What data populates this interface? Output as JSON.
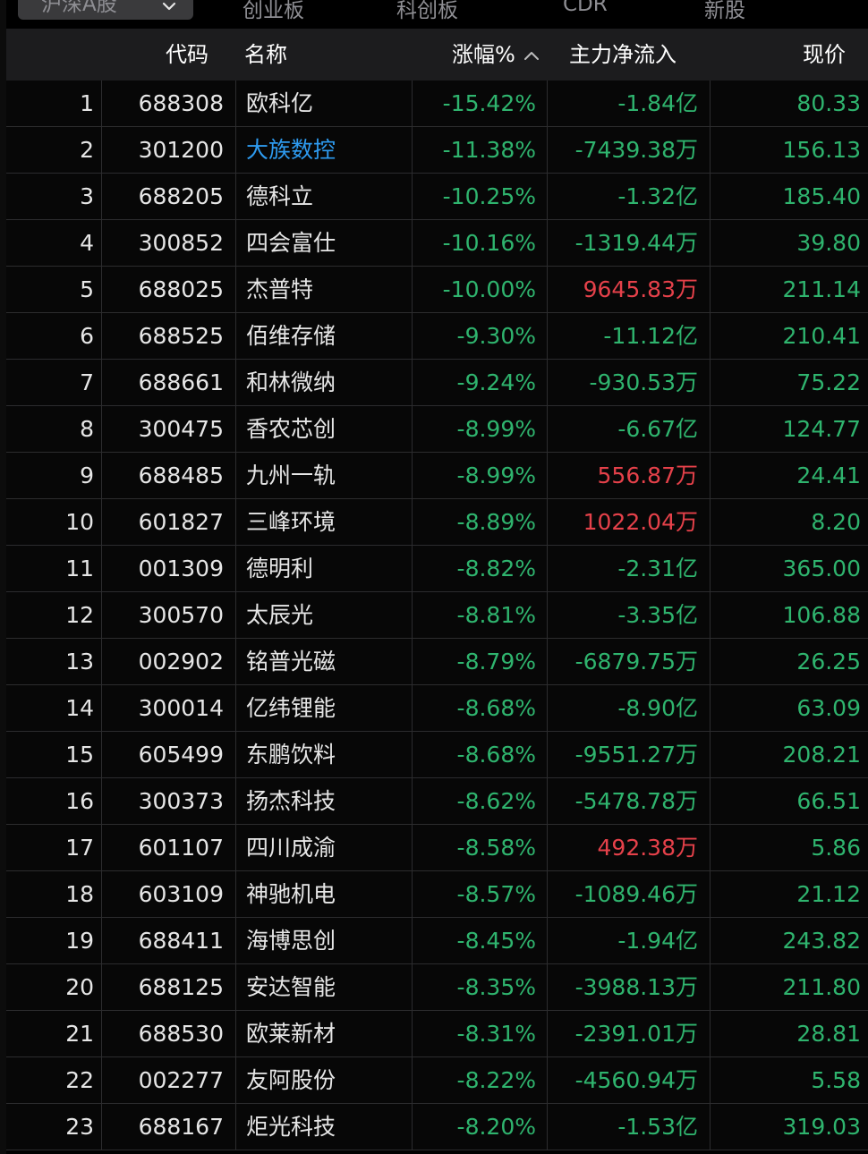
{
  "tabs": {
    "selected": "沪深A股",
    "items": [
      "创业板",
      "科创板",
      "CDR",
      "新股"
    ]
  },
  "columns": {
    "code": "代码",
    "name": "名称",
    "change": "涨幅%",
    "flow": "主力净流入",
    "price": "现价"
  },
  "colors": {
    "down": "#2fb46e",
    "up": "#e5414a",
    "highlight": "#2e9bf0",
    "header_bg": "#1c1c1e"
  },
  "rows": [
    {
      "n": "1",
      "code": "688308",
      "name": "欧科亿",
      "change": "-15.42%",
      "flow": "-1.84亿",
      "price": "80.33",
      "flow_color": "green",
      "name_color": "white"
    },
    {
      "n": "2",
      "code": "301200",
      "name": "大族数控",
      "change": "-11.38%",
      "flow": "-7439.38万",
      "price": "156.13",
      "flow_color": "green",
      "name_color": "blue"
    },
    {
      "n": "3",
      "code": "688205",
      "name": "德科立",
      "change": "-10.25%",
      "flow": "-1.32亿",
      "price": "185.40",
      "flow_color": "green",
      "name_color": "white"
    },
    {
      "n": "4",
      "code": "300852",
      "name": "四会富仕",
      "change": "-10.16%",
      "flow": "-1319.44万",
      "price": "39.80",
      "flow_color": "green",
      "name_color": "white"
    },
    {
      "n": "5",
      "code": "688025",
      "name": "杰普特",
      "change": "-10.00%",
      "flow": "9645.83万",
      "price": "211.14",
      "flow_color": "red",
      "name_color": "white"
    },
    {
      "n": "6",
      "code": "688525",
      "name": "佰维存储",
      "change": "-9.30%",
      "flow": "-11.12亿",
      "price": "210.41",
      "flow_color": "green",
      "name_color": "white"
    },
    {
      "n": "7",
      "code": "688661",
      "name": "和林微纳",
      "change": "-9.24%",
      "flow": "-930.53万",
      "price": "75.22",
      "flow_color": "green",
      "name_color": "white"
    },
    {
      "n": "8",
      "code": "300475",
      "name": "香农芯创",
      "change": "-8.99%",
      "flow": "-6.67亿",
      "price": "124.77",
      "flow_color": "green",
      "name_color": "white"
    },
    {
      "n": "9",
      "code": "688485",
      "name": "九州一轨",
      "change": "-8.99%",
      "flow": "556.87万",
      "price": "24.41",
      "flow_color": "red",
      "name_color": "white"
    },
    {
      "n": "10",
      "code": "601827",
      "name": "三峰环境",
      "change": "-8.89%",
      "flow": "1022.04万",
      "price": "8.20",
      "flow_color": "red",
      "name_color": "white"
    },
    {
      "n": "11",
      "code": "001309",
      "name": "德明利",
      "change": "-8.82%",
      "flow": "-2.31亿",
      "price": "365.00",
      "flow_color": "green",
      "name_color": "white"
    },
    {
      "n": "12",
      "code": "300570",
      "name": "太辰光",
      "change": "-8.81%",
      "flow": "-3.35亿",
      "price": "106.88",
      "flow_color": "green",
      "name_color": "white"
    },
    {
      "n": "13",
      "code": "002902",
      "name": "铭普光磁",
      "change": "-8.79%",
      "flow": "-6879.75万",
      "price": "26.25",
      "flow_color": "green",
      "name_color": "white"
    },
    {
      "n": "14",
      "code": "300014",
      "name": "亿纬锂能",
      "change": "-8.68%",
      "flow": "-8.90亿",
      "price": "63.09",
      "flow_color": "green",
      "name_color": "white"
    },
    {
      "n": "15",
      "code": "605499",
      "name": "东鹏饮料",
      "change": "-8.68%",
      "flow": "-9551.27万",
      "price": "208.21",
      "flow_color": "green",
      "name_color": "white"
    },
    {
      "n": "16",
      "code": "300373",
      "name": "扬杰科技",
      "change": "-8.62%",
      "flow": "-5478.78万",
      "price": "66.51",
      "flow_color": "green",
      "name_color": "white"
    },
    {
      "n": "17",
      "code": "601107",
      "name": "四川成渝",
      "change": "-8.58%",
      "flow": "492.38万",
      "price": "5.86",
      "flow_color": "red",
      "name_color": "white"
    },
    {
      "n": "18",
      "code": "603109",
      "name": "神驰机电",
      "change": "-8.57%",
      "flow": "-1089.46万",
      "price": "21.12",
      "flow_color": "green",
      "name_color": "white"
    },
    {
      "n": "19",
      "code": "688411",
      "name": "海博思创",
      "change": "-8.45%",
      "flow": "-1.94亿",
      "price": "243.82",
      "flow_color": "green",
      "name_color": "white"
    },
    {
      "n": "20",
      "code": "688125",
      "name": "安达智能",
      "change": "-8.35%",
      "flow": "-3988.13万",
      "price": "211.80",
      "flow_color": "green",
      "name_color": "white"
    },
    {
      "n": "21",
      "code": "688530",
      "name": "欧莱新材",
      "change": "-8.31%",
      "flow": "-2391.01万",
      "price": "28.81",
      "flow_color": "green",
      "name_color": "white"
    },
    {
      "n": "22",
      "code": "002277",
      "name": "友阿股份",
      "change": "-8.22%",
      "flow": "-4560.94万",
      "price": "5.58",
      "flow_color": "green",
      "name_color": "white"
    },
    {
      "n": "23",
      "code": "688167",
      "name": "炬光科技",
      "change": "-8.20%",
      "flow": "-1.53亿",
      "price": "319.03",
      "flow_color": "green",
      "name_color": "white"
    }
  ]
}
